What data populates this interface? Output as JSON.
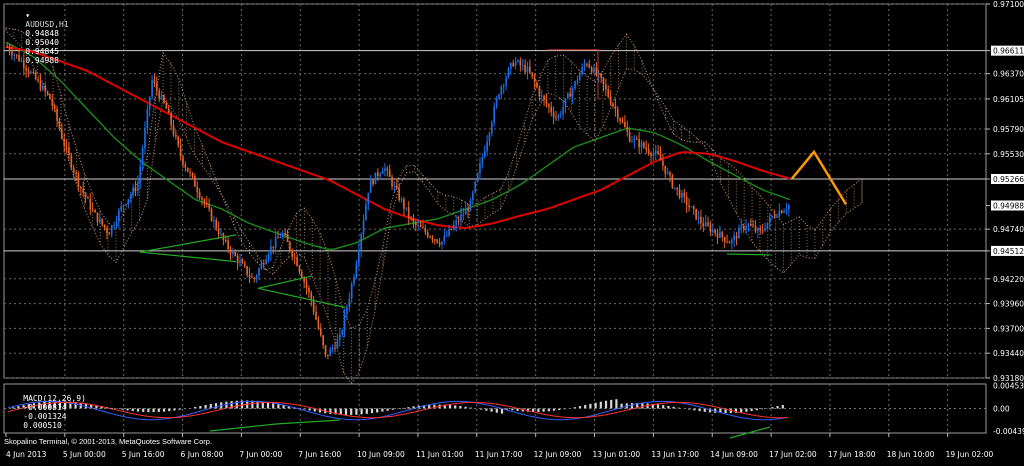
{
  "window": {
    "symbol_line": [
      "AUDUSD,H1",
      "0.94848",
      "0.95040",
      "0.94845",
      "0.94988"
    ],
    "copyright": "Skopalino Terminal, © 2001-2013, MetaQuotes Software Corp."
  },
  "colors": {
    "background": "#000000",
    "bull_candle": "#1e6ee6",
    "bear_candle": "#e8642a",
    "ma_slow": "#e00000",
    "ma_fast": "#1a8a1a",
    "cloud_a": "#d2a078",
    "cloud_b": "#d0d0d0",
    "horizontal_level": "#d0d0d0",
    "projection": "#ff9900",
    "divergence": "#22aa22",
    "macd_hist": "#d8d8d8",
    "macd_main": "#3060ff",
    "macd_signal": "#ff3030",
    "grid": "#6a6a6a"
  },
  "chart_data": [
    {
      "type": "candlestick",
      "symbol": "AUDUSD",
      "timeframe": "H1",
      "title": "AUDUSD,H1",
      "ohlc_last": {
        "open": 0.94848,
        "high": 0.9504,
        "low": 0.94845,
        "close": 0.94988
      },
      "ylim": [
        0.9318,
        0.971
      ],
      "price_ticks": [
        "0.97100",
        "0.96611",
        "0.96370",
        "0.96105",
        "0.95790",
        "0.95530",
        "0.95266",
        "0.94988",
        "0.94740",
        "0.94512",
        "0.94220",
        "0.93960",
        "0.93700",
        "0.93440",
        "0.93180"
      ],
      "highlighted_ticks": [
        "0.96611",
        "0.95266",
        "0.94988",
        "0.94512"
      ],
      "horizontal_levels": [
        0.96611,
        0.95266,
        0.94512
      ],
      "x_labels": [
        "4 Jun 2013",
        "5 Jun 00:00",
        "5 Jun 16:00",
        "6 Jun 08:00",
        "7 Jun 00:00",
        "7 Jun 16:00",
        "10 Jun 09:00",
        "11 Jun 01:00",
        "11 Jun 17:00",
        "12 Jun 09:00",
        "13 Jun 01:00",
        "13 Jun 17:00",
        "14 Jun 09:00",
        "17 Jun 02:00",
        "17 Jun 18:00",
        "18 Jun 10:00",
        "19 Jun 02:00"
      ],
      "grid": true,
      "series": [
        {
          "name": "",
          "kind": "price_path",
          "values": [
            0.9665,
            0.965,
            0.963,
            0.961,
            0.956,
            0.952,
            0.949,
            0.947,
            0.95,
            0.952,
            0.963,
            0.96,
            0.955,
            0.952,
            0.949,
            0.946,
            0.944,
            0.942,
            0.945,
            0.947,
            0.944,
            0.94,
            0.934,
            0.936,
            0.943,
            0.952,
            0.954,
            0.951,
            0.948,
            0.947,
            0.946,
            0.948,
            0.95,
            0.956,
            0.962,
            0.965,
            0.964,
            0.961,
            0.959,
            0.962,
            0.965,
            0.963,
            0.96,
            0.957,
            0.956,
            0.955,
            0.952,
            0.95,
            0.948,
            0.947,
            0.946,
            0.948,
            0.947,
            0.949,
            0.9499
          ]
        },
        {
          "name": "",
          "kind": "ma_slow",
          "values": [
            0.9665,
            0.966,
            0.965,
            0.964,
            0.9625,
            0.961,
            0.9595,
            0.958,
            0.9565,
            0.9555,
            0.9545,
            0.9535,
            0.9525,
            0.951,
            0.9495,
            0.9485,
            0.9478,
            0.9475,
            0.948,
            0.9488,
            0.9495,
            0.9505,
            0.9515,
            0.953,
            0.9545,
            0.9555,
            0.9553,
            0.9545,
            0.9535,
            0.9527
          ]
        },
        {
          "name": "",
          "kind": "ma_fast",
          "values": [
            0.967,
            0.9655,
            0.963,
            0.96,
            0.957,
            0.9545,
            0.9525,
            0.9505,
            0.9495,
            0.948,
            0.947,
            0.946,
            0.9452,
            0.946,
            0.9475,
            0.948,
            0.9485,
            0.9495,
            0.9505,
            0.952,
            0.954,
            0.956,
            0.957,
            0.958,
            0.9575,
            0.9562,
            0.9545,
            0.953,
            0.9515,
            0.9505
          ]
        },
        {
          "name": "",
          "kind": "projection",
          "values": [
            0.9527,
            0.9555,
            0.95
          ]
        }
      ]
    },
    {
      "type": "macd",
      "label": "MACD(12,26,9)",
      "values_shown": [
        "-0.000814",
        "-0.001324",
        "0.000510"
      ],
      "ticks": [
        "0.00453",
        "0.00",
        "-0.00439"
      ],
      "ylim": [
        -0.0048,
        0.0048
      ]
    }
  ]
}
